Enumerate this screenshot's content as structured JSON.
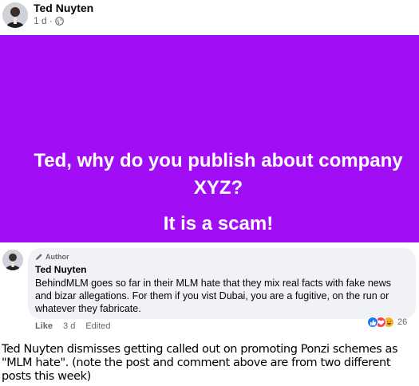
{
  "post": {
    "author": "Ted Nuyten",
    "time": "1 d",
    "separator": "·"
  },
  "card": {
    "line1": "Ted, why do you publish about company",
    "line2": "XYZ?",
    "line3": "It is a scam!",
    "background_color": "#a10ef5"
  },
  "comment": {
    "badge": "Author",
    "author": "Ted Nuyten",
    "text": "BehindMLM goes so far in their MLM hate that they mix real facts with fake news and bizar allegations. For them if you vist Dubai, you are a fugitive, on the run or whatever they fabricate.",
    "actions": {
      "like": "Like",
      "time": "3 d",
      "edited": "Edited"
    },
    "reactions": {
      "icons": [
        "like-icon",
        "love-icon",
        "haha-icon"
      ],
      "count": "26"
    }
  },
  "caption": "Ted Nuyten dismisses getting called out on promoting Ponzi schemes as \"MLM hate\". (note the post and comment above are from two different posts this week)"
}
